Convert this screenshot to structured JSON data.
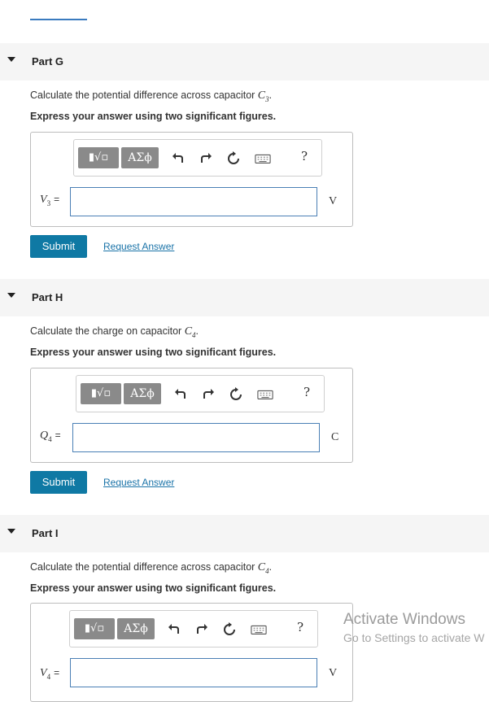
{
  "parts": [
    {
      "title": "Part G",
      "question_prefix": "Calculate the potential difference across capacitor ",
      "question_var": "C",
      "question_sub": "3",
      "instruction": "Express your answer using two significant figures.",
      "var_symbol": "V",
      "var_sub": "3",
      "equals": "=",
      "unit": "V",
      "input_value": "",
      "submit_label": "Submit",
      "request_label": "Request Answer"
    },
    {
      "title": "Part H",
      "question_prefix": "Calculate the charge on capacitor ",
      "question_var": "C",
      "question_sub": "4",
      "instruction": "Express your answer using two significant figures.",
      "var_symbol": "Q",
      "var_sub": "4",
      "equals": "=",
      "unit": "C",
      "input_value": "",
      "submit_label": "Submit",
      "request_label": "Request Answer"
    },
    {
      "title": "Part I",
      "question_prefix": "Calculate the potential difference across capacitor ",
      "question_var": "C",
      "question_sub": "4",
      "instruction": "Express your answer using two significant figures.",
      "var_symbol": "V",
      "var_sub": "4",
      "equals": "=",
      "unit": "V",
      "input_value": ""
    }
  ],
  "toolbar": {
    "template_btn": "▮√▫",
    "symbols_btn": "ΑΣϕ",
    "help": "?"
  },
  "watermark": {
    "line1": "Activate Windows",
    "line2": "Go to Settings to activate W"
  }
}
